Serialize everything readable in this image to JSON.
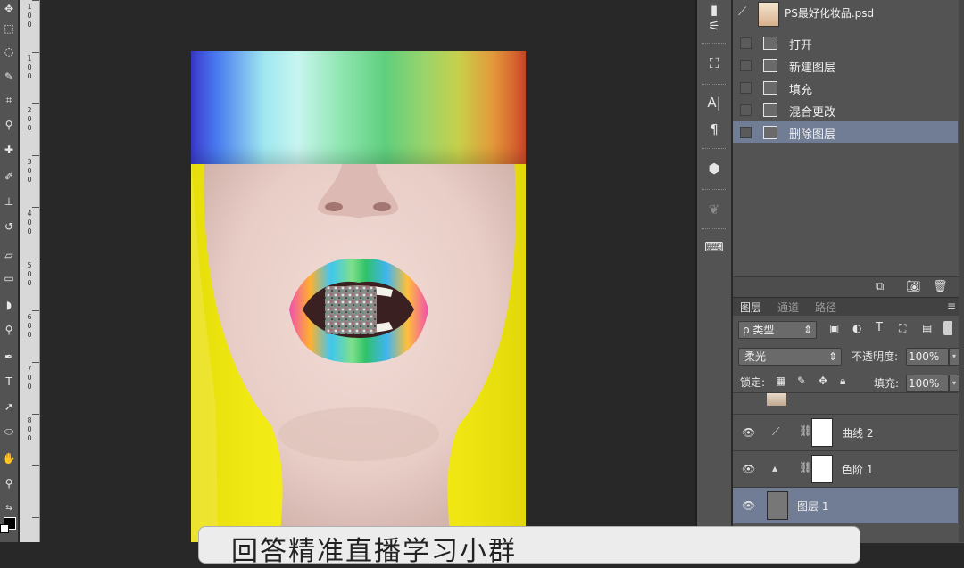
{
  "document": {
    "file_name": "PS最好化妆品.psd"
  },
  "history": {
    "items": [
      {
        "label": "打开",
        "selected": false
      },
      {
        "label": "新建图层",
        "selected": false
      },
      {
        "label": "填充",
        "selected": false
      },
      {
        "label": "混合更改",
        "selected": false
      },
      {
        "label": "删除图层",
        "selected": true
      }
    ]
  },
  "layers_panel": {
    "tabs": [
      {
        "label": "图层",
        "active": true
      },
      {
        "label": "通道",
        "active": false
      },
      {
        "label": "路径",
        "active": false
      }
    ],
    "filter_kind": "ρ 类型",
    "blend_mode": "柔光",
    "opacity_label": "不透明度:",
    "opacity_value": "100%",
    "lock_label": "锁定:",
    "fill_label": "填充:",
    "fill_value": "100%",
    "layers": [
      {
        "name": "曲线 2",
        "visible": true,
        "type": "adjustment",
        "selected": false
      },
      {
        "name": "色阶 1",
        "visible": true,
        "type": "adjustment",
        "selected": false
      },
      {
        "name": "图层 1",
        "visible": true,
        "type": "pixel",
        "selected": true
      }
    ]
  },
  "ruler": {
    "marks": [
      "1",
      "0",
      "0",
      "1",
      "0",
      "0",
      "2",
      "0",
      "0",
      "3",
      "0",
      "0",
      "4",
      "0",
      "0",
      "5",
      "0",
      "0",
      "6",
      "0",
      "0",
      "7",
      "0",
      "0",
      "8",
      "0",
      "0"
    ]
  },
  "subtitle": {
    "text": "回答精准直播学习小群"
  },
  "colors": {
    "selection": "#707d94",
    "panel": "#535353",
    "canvas": "#282828"
  }
}
